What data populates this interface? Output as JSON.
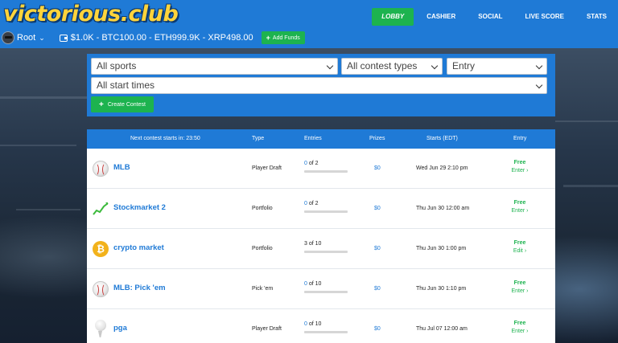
{
  "header": {
    "logo": "victorious.club",
    "nav": [
      {
        "label": "LOBBY",
        "active": true
      },
      {
        "label": "CASHIER",
        "active": false
      },
      {
        "label": "SOCIAL",
        "active": false
      },
      {
        "label": "LIVE SCORE",
        "active": false
      },
      {
        "label": "STATS",
        "active": false
      }
    ],
    "user": {
      "name": "Root"
    },
    "balances": "$1.0K - BTC100.00 - ETH999.9K - XRP498.00",
    "add_funds_label": "Add Funds"
  },
  "filters": {
    "sport": "All sports",
    "contest_type": "All contest types",
    "entry": "Entry",
    "start_time": "All start times",
    "create_label": "Create Contest"
  },
  "table": {
    "headers": {
      "next": "Next contest starts in: 23:50",
      "type": "Type",
      "entries": "Entries",
      "prizes": "Prizes",
      "starts": "Starts (EDT)",
      "entry": "Entry"
    },
    "rows": [
      {
        "icon": "baseball-icon",
        "name": "MLB",
        "type": "Player Draft",
        "entries_count": "0",
        "entries_max": "of 2",
        "progress": 0.0,
        "prize": "$0",
        "starts": "Wed Jun 29 2:10 pm",
        "fee": "Free",
        "action": "Enter"
      },
      {
        "icon": "stock-chart-icon",
        "name": "Stockmarket 2",
        "type": "Portfolio",
        "entries_count": "0",
        "entries_max": "of 2",
        "progress": 0.0,
        "prize": "$0",
        "starts": "Thu Jun 30 12:00 am",
        "fee": "Free",
        "action": "Enter"
      },
      {
        "icon": "bitcoin-icon",
        "name": "crypto market",
        "type": "Portfolio",
        "entries_count": "3",
        "entries_max": "of 10",
        "progress": 0.3,
        "prize": "$0",
        "starts": "Thu Jun 30 1:00 pm",
        "fee": "Free",
        "action": "Edit"
      },
      {
        "icon": "baseball-icon",
        "name": "MLB: Pick 'em",
        "type": "Pick 'em",
        "entries_count": "0",
        "entries_max": "of 10",
        "progress": 0.0,
        "prize": "$0",
        "starts": "Thu Jun 30 1:10 pm",
        "fee": "Free",
        "action": "Enter"
      },
      {
        "icon": "golf-ball-icon",
        "name": "pga",
        "type": "Player Draft",
        "entries_count": "0",
        "entries_max": "of 10",
        "progress": 0.0,
        "prize": "$0",
        "starts": "Thu Jul 07 12:00 am",
        "fee": "Free",
        "action": "Enter"
      }
    ]
  },
  "colors": {
    "brand_blue": "#1f7ad6",
    "green": "#1db34f",
    "logo_yellow": "#ffd43b"
  }
}
